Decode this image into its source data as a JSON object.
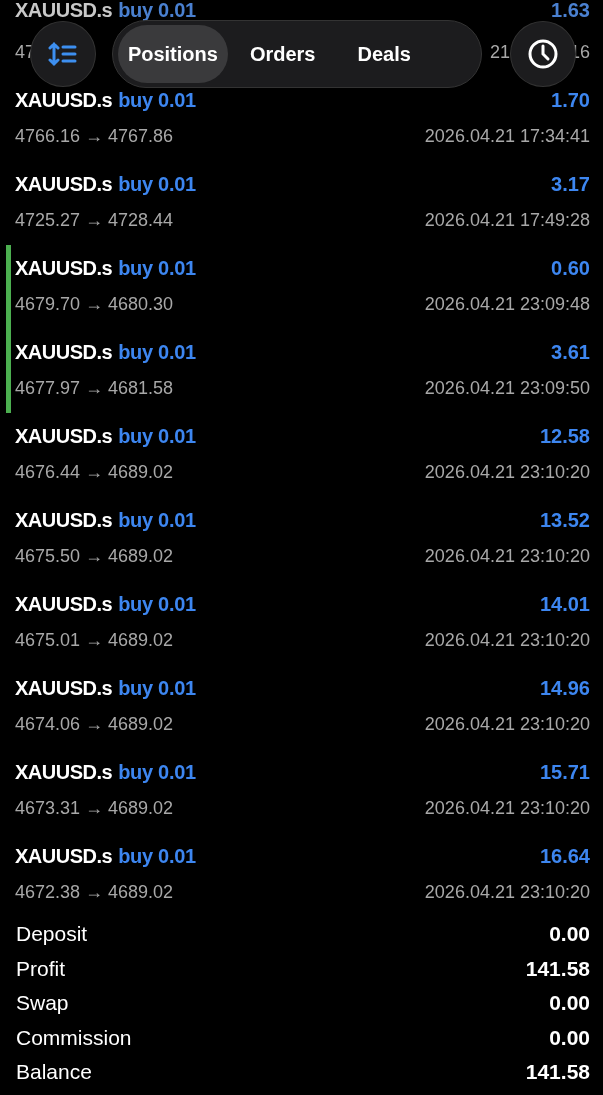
{
  "toolbar": {
    "tabs": [
      {
        "label": "Positions",
        "selected": true
      },
      {
        "label": "Orders",
        "selected": false
      },
      {
        "label": "Deals",
        "selected": false
      }
    ]
  },
  "deals": [
    {
      "symbol": "XAUUSD.s",
      "action": "buy 0.01",
      "profit": "1.63",
      "prices": "47",
      "time": "21",
      "time_end": "16",
      "marked": false
    },
    {
      "symbol": "XAUUSD.s",
      "action": "buy 0.01",
      "profit": "1.70",
      "prices": "4766.16 → 4767.86",
      "time": "2026.04.21 17:34:41",
      "marked": false
    },
    {
      "symbol": "XAUUSD.s",
      "action": "buy 0.01",
      "profit": "3.17",
      "prices": "4725.27 → 4728.44",
      "time": "2026.04.21 17:49:28",
      "marked": false
    },
    {
      "symbol": "XAUUSD.s",
      "action": "buy 0.01",
      "profit": "0.60",
      "prices": "4679.70 → 4680.30",
      "time": "2026.04.21 23:09:48",
      "marked": true
    },
    {
      "symbol": "XAUUSD.s",
      "action": "buy 0.01",
      "profit": "3.61",
      "prices": "4677.97 → 4681.58",
      "time": "2026.04.21 23:09:50",
      "marked": true
    },
    {
      "symbol": "XAUUSD.s",
      "action": "buy 0.01",
      "profit": "12.58",
      "prices": "4676.44 → 4689.02",
      "time": "2026.04.21 23:10:20",
      "marked": false
    },
    {
      "symbol": "XAUUSD.s",
      "action": "buy 0.01",
      "profit": "13.52",
      "prices": "4675.50 → 4689.02",
      "time": "2026.04.21 23:10:20",
      "marked": false
    },
    {
      "symbol": "XAUUSD.s",
      "action": "buy 0.01",
      "profit": "14.01",
      "prices": "4675.01 → 4689.02",
      "time": "2026.04.21 23:10:20",
      "marked": false
    },
    {
      "symbol": "XAUUSD.s",
      "action": "buy 0.01",
      "profit": "14.96",
      "prices": "4674.06 → 4689.02",
      "time": "2026.04.21 23:10:20",
      "marked": false
    },
    {
      "symbol": "XAUUSD.s",
      "action": "buy 0.01",
      "profit": "15.71",
      "prices": "4673.31 → 4689.02",
      "time": "2026.04.21 23:10:20",
      "marked": false
    },
    {
      "symbol": "XAUUSD.s",
      "action": "buy 0.01",
      "profit": "16.64",
      "prices": "4672.38 → 4689.02",
      "time": "2026.04.21 23:10:20",
      "marked": false
    }
  ],
  "summary": [
    {
      "label": "Deposit",
      "value": "0.00"
    },
    {
      "label": "Profit",
      "value": "141.58"
    },
    {
      "label": "Swap",
      "value": "0.00"
    },
    {
      "label": "Commission",
      "value": "0.00"
    },
    {
      "label": "Balance",
      "value": "141.58"
    }
  ]
}
